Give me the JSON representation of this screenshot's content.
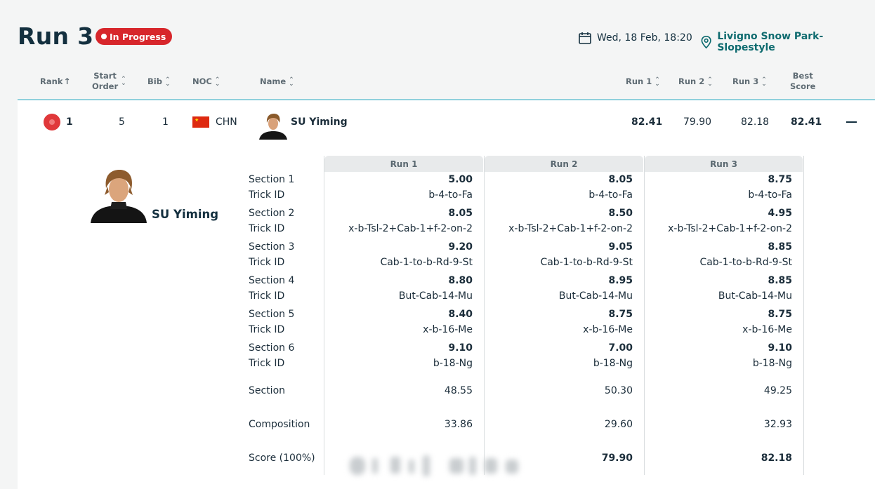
{
  "page": {
    "title": "Run 3",
    "status_badge": "In Progress",
    "date": "Wed, 18 Feb, 18:20",
    "venue": "Livigno Snow Park-Slopestyle"
  },
  "columns": {
    "rank": "Rank",
    "start_order_1": "Start",
    "start_order_2": "Order",
    "bib": "Bib",
    "noc": "NOC",
    "name": "Name",
    "run1": "Run 1",
    "run2": "Run 2",
    "run3": "Run 3",
    "best_1": "Best",
    "best_2": "Score"
  },
  "athlete": {
    "rank": "1",
    "start_order": "5",
    "bib": "1",
    "noc": "CHN",
    "name": "SU Yiming",
    "run1": "82.41",
    "run2": "79.90",
    "run3": "82.18",
    "best": "82.41"
  },
  "detail": {
    "run_headers": [
      "Run 1",
      "Run 2",
      "Run 3"
    ],
    "row_labels": [
      "Section 1",
      "Trick ID",
      "Section 2",
      "Trick ID",
      "Section 3",
      "Trick ID",
      "Section 4",
      "Trick ID",
      "Section 5",
      "Trick ID",
      "Section 6",
      "Trick ID",
      "Section",
      "Composition",
      "Score (100%)"
    ],
    "runs": [
      {
        "sections": [
          {
            "score": "5.00",
            "trick": "b-4-to-Fa"
          },
          {
            "score": "8.05",
            "trick": "x-b-Tsl-2+Cab-1+f-2-on-2"
          },
          {
            "score": "9.20",
            "trick": "Cab-1-to-b-Rd-9-St"
          },
          {
            "score": "8.80",
            "trick": "But-Cab-14-Mu"
          },
          {
            "score": "8.40",
            "trick": "x-b-16-Me"
          },
          {
            "score": "9.10",
            "trick": "b-18-Ng"
          }
        ],
        "section_total": "48.55",
        "composition": "33.86",
        "score": ""
      },
      {
        "sections": [
          {
            "score": "8.05",
            "trick": "b-4-to-Fa"
          },
          {
            "score": "8.50",
            "trick": "x-b-Tsl-2+Cab-1+f-2-on-2"
          },
          {
            "score": "9.05",
            "trick": "Cab-1-to-b-Rd-9-St"
          },
          {
            "score": "8.95",
            "trick": "But-Cab-14-Mu"
          },
          {
            "score": "8.75",
            "trick": "x-b-16-Me"
          },
          {
            "score": "7.00",
            "trick": "b-18-Ng"
          }
        ],
        "section_total": "50.30",
        "composition": "29.60",
        "score": "79.90"
      },
      {
        "sections": [
          {
            "score": "8.75",
            "trick": "b-4-to-Fa"
          },
          {
            "score": "4.95",
            "trick": "x-b-Tsl-2+Cab-1+f-2-on-2"
          },
          {
            "score": "8.85",
            "trick": "Cab-1-to-b-Rd-9-St"
          },
          {
            "score": "8.85",
            "trick": "But-Cab-14-Mu"
          },
          {
            "score": "8.75",
            "trick": "x-b-16-Me"
          },
          {
            "score": "9.10",
            "trick": "b-18-Ng"
          }
        ],
        "section_total": "49.25",
        "composition": "32.93",
        "score": "82.18"
      }
    ]
  },
  "colors": {
    "accent_teal": "#0e6b6f",
    "badge_red": "#d7262b",
    "header_rule": "#8fd0dc",
    "title": "#14303f"
  },
  "icons": {
    "date": "calendar-icon",
    "venue": "location-pin-icon",
    "collapse": "minus-icon"
  }
}
